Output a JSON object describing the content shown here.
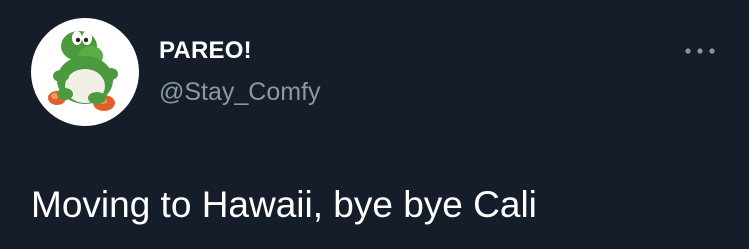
{
  "tweet": {
    "author": {
      "display_name": "PAREO!",
      "handle": "@Stay_Comfy",
      "avatar_icon": "yoshi-avatar-icon"
    },
    "text": "Moving to Hawaii, bye bye Cali",
    "menu_icon": "more-horizontal-icon"
  },
  "colors": {
    "background": "#151c2a",
    "primary_text": "#ffffff",
    "secondary_text": "#8b98a5",
    "avatar_background": "#ffffff"
  }
}
